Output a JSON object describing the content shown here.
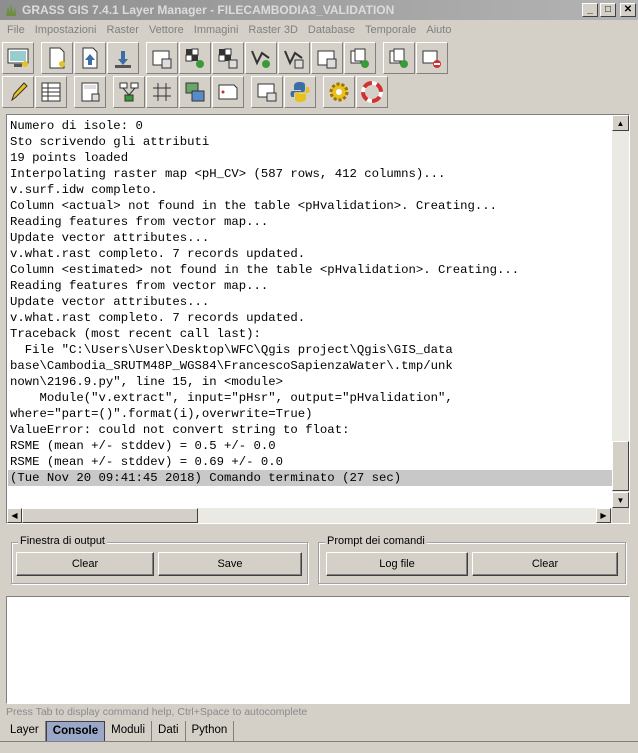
{
  "window": {
    "title": "GRASS GIS 7.4.1 Layer Manager - FILECAMBODIA3_VALIDATION",
    "minimize": "_",
    "maximize": "□",
    "close": "✕"
  },
  "menu": [
    "File",
    "Impostazioni",
    "Raster",
    "Vettore",
    "Immagini",
    "Raster 3D",
    "Database",
    "Temporale",
    "Aiuto"
  ],
  "toolbar1_icons": [
    "display-map-icon",
    "new-workspace-icon",
    "open-workspace-icon",
    "save-workspace-icon",
    "add-raster-icon",
    "add-multiple-rasters-icon",
    "add-raster-misc-icon",
    "add-vector-icon",
    "add-vector-misc-icon",
    "add-overlay-icon",
    "add-group-icon",
    "duplicate-layer-icon",
    "remove-layer-icon"
  ],
  "toolbar2_icons": [
    "edit-vector-icon",
    "attribute-table-icon",
    "map-calculator-icon",
    "graphical-modeler-icon",
    "georectifier-icon",
    "cartographic-composer-icon",
    "script-icon",
    "python-icon",
    "settings-icon",
    "help-icon"
  ],
  "output_lines": [
    "Numero di isole: 0",
    "Sto scrivendo gli attributi",
    "19 points loaded",
    "Interpolating raster map <pH_CV> (587 rows, 412 columns)...",
    "v.surf.idw completo.",
    "Column <actual> not found in the table <pHvalidation>. Creating...",
    "Reading features from vector map...",
    "Update vector attributes...",
    "v.what.rast completo. 7 records updated.",
    "Column <estimated> not found in the table <pHvalidation>. Creating...",
    "Reading features from vector map...",
    "Update vector attributes...",
    "v.what.rast completo. 7 records updated.",
    "Traceback (most recent call last):",
    "  File \"C:\\Users\\User\\Desktop\\WFC\\Qgis project\\Qgis\\GIS_data",
    "base\\Cambodia_SRUTM48P_WGS84\\FrancescoSapienzaWater\\.tmp/unk",
    "nown\\2196.9.py\", line 15, in <module>",
    "    Module(\"v.extract\", input=\"pHsr\", output=\"pHvalidation\",",
    "where=\"part=()\".format(i),overwrite=True)",
    "ValueError: could not convert string to float:",
    "RSME (mean +/- stddev) = 0.5 +/- 0.0",
    "RSME (mean +/- stddev) = 0.69 +/- 0.0",
    "(Tue Nov 20 09:41:45 2018) Comando terminato (27 sec)"
  ],
  "output_panel": {
    "title": "Finestra di output",
    "clear_label": "Clear",
    "save_label": "Save"
  },
  "prompt_panel": {
    "title": "Prompt dei comandi",
    "logfile_label": "Log file",
    "clear_label": "Clear"
  },
  "status_hint": "Press Tab to display command help, Ctrl+Space to autocomplete",
  "tabs": [
    "Layer",
    "Console",
    "Moduli",
    "Dati",
    "Python"
  ],
  "active_tab": "Console"
}
